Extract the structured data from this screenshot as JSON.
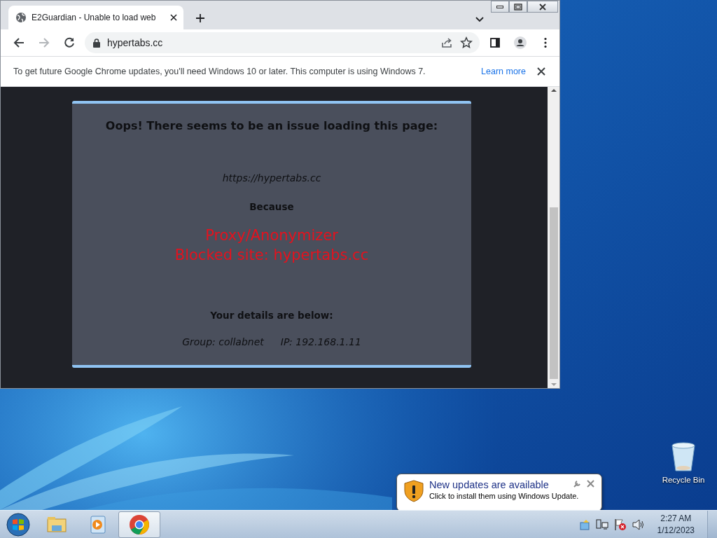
{
  "browser": {
    "tab": {
      "title": "E2Guardian - Unable to load web",
      "selected": true
    },
    "address": "hypertabs.cc",
    "infobar": {
      "message": "To get future Google Chrome updates, you'll need Windows 10 or later. This computer is using Windows 7.",
      "link": "Learn more"
    }
  },
  "page": {
    "heading": "Oops! There seems to be an issue loading this page:",
    "url": "https://hypertabs.cc",
    "because": "Because",
    "reasons": [
      "Proxy/Anonymizer",
      "Blocked site: hypertabs.cc"
    ],
    "details_heading": "Your details are below:",
    "group": "Group: collabnet",
    "ip": "IP: 192.168.1.11"
  },
  "desktop": {
    "icons": [
      {
        "label": "Recycle Bin"
      }
    ]
  },
  "notification": {
    "title": "New updates are available",
    "message": "Click to install them using Windows Update."
  },
  "taskbar": {
    "apps": [
      {
        "kind": "explorer",
        "selected": false
      },
      {
        "kind": "media",
        "selected": false
      },
      {
        "kind": "chrome",
        "selected": true
      }
    ],
    "time": "2:27 AM",
    "date": "1/12/2023"
  }
}
